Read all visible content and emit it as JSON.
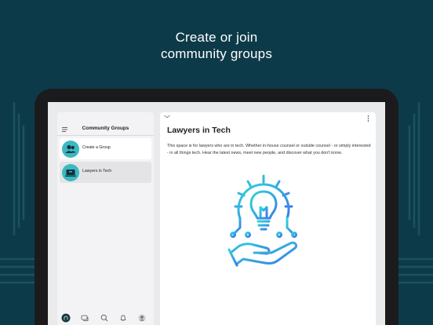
{
  "headline": {
    "line1": "Create or join",
    "line2": "community groups"
  },
  "sidebar": {
    "title": "Community Groups",
    "items": [
      {
        "label": "Create a Group",
        "icon": "people-icon",
        "active": false
      },
      {
        "label": "Lawyers in Tech",
        "icon": "laptop-gavel-icon",
        "active": true
      }
    ],
    "tabs": [
      "home-icon",
      "chat-icon",
      "search-icon",
      "bell-icon",
      "profile-avatar"
    ]
  },
  "content": {
    "title": "Lawyers in Tech",
    "description": "This space is for lawyers who are in tech. Whether in-house counsel or outside counsel - or simply interested - in all things tech. Hear the latest news, meet new people, and discover what you don't know.",
    "illustration": "lightbulb-gear-hand-icon"
  },
  "colors": {
    "background": "#0d3a48",
    "accent": "#3bb8c2",
    "gradient_start": "#2fd6d8",
    "gradient_end": "#3b7be8"
  }
}
